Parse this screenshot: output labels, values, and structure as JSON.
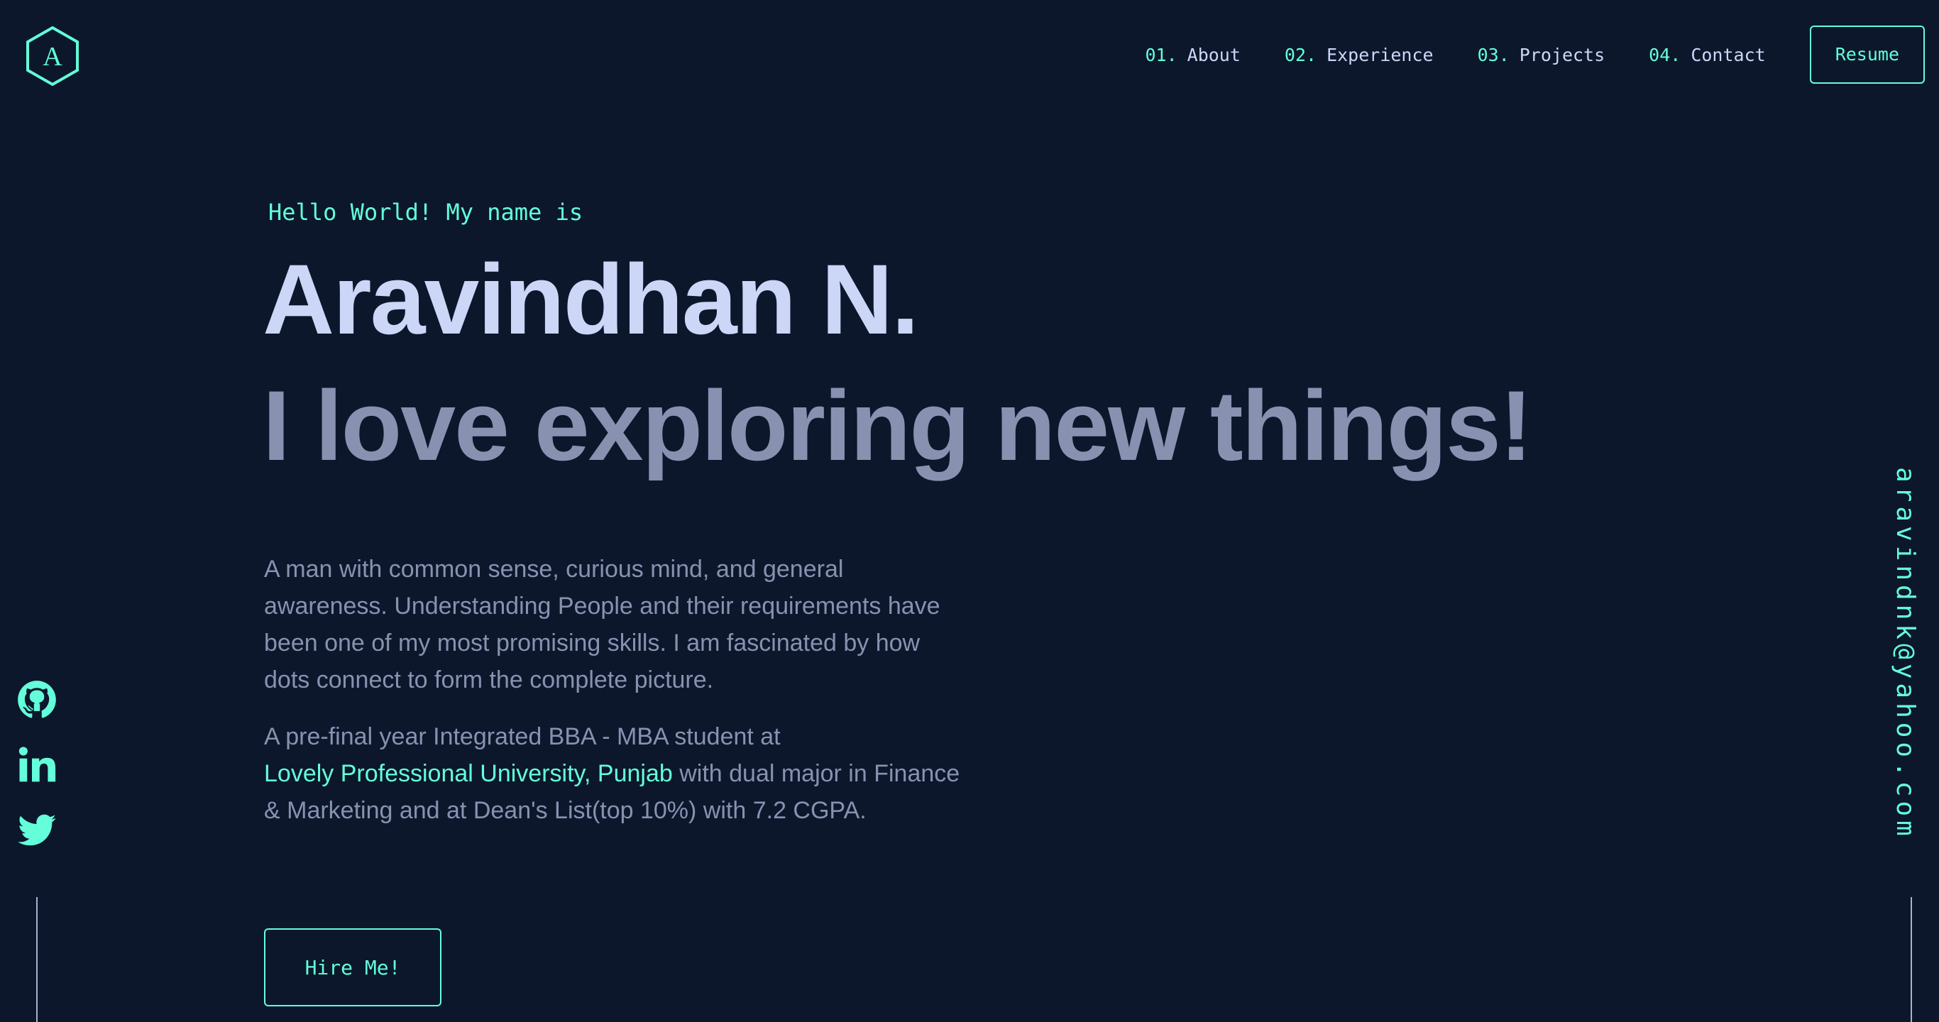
{
  "header": {
    "logo_letter": "A",
    "nav": [
      {
        "num": "01.",
        "label": "About"
      },
      {
        "num": "02.",
        "label": "Experience"
      },
      {
        "num": "03.",
        "label": "Projects"
      },
      {
        "num": "04.",
        "label": "Contact"
      }
    ],
    "resume_label": "Resume"
  },
  "hero": {
    "greeting": "Hello World! My name is",
    "name": "Aravindhan N.",
    "tagline": "I love exploring new things!",
    "bio1_lines": [
      "A man with common sense, curious mind, and general",
      "awareness. Understanding People and their requirements have",
      "been one of my most promising skills. I am fascinated by how",
      "dots connect to form the complete picture."
    ],
    "bio2_line1": "A pre-final year Integrated BBA - MBA student at",
    "bio2_link": "Lovely Professional University, Punjab",
    "bio2_after_link": " with dual major in Finance",
    "bio2_line3": "& Marketing and at Dean's List(top 10%) with 7.2 CGPA.",
    "cta_label": "Hire Me!"
  },
  "social": [
    {
      "icon": "github-icon"
    },
    {
      "icon": "linkedin-icon"
    },
    {
      "icon": "twitter-icon"
    }
  ],
  "email": "aravindnk@yahoo.com",
  "colors": {
    "background": "#0c172c",
    "accent": "#64ffda",
    "heading": "#ccd6f6",
    "text": "#8892b0"
  }
}
